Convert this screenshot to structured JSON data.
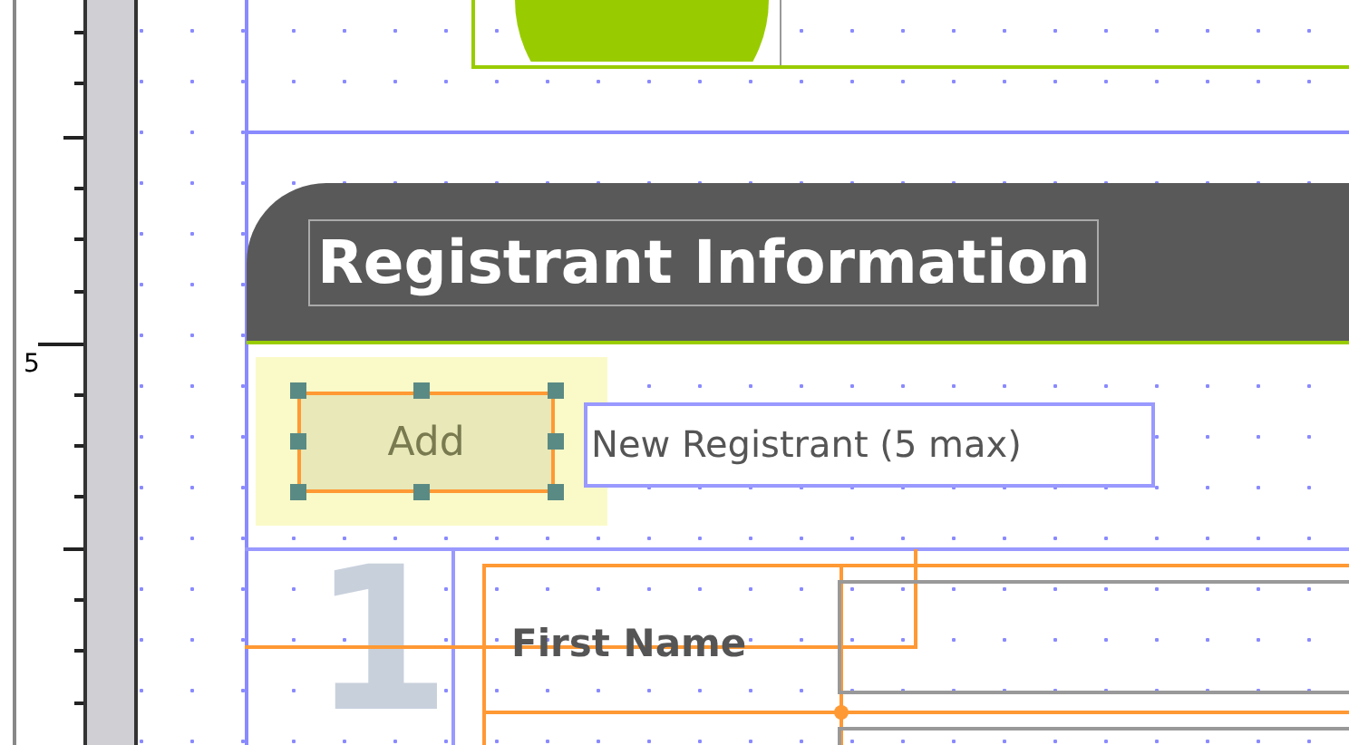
{
  "ruler": {
    "labels": [
      "5"
    ]
  },
  "header": {
    "title": "Registrant Information"
  },
  "add_control": {
    "label": "Add",
    "selected": true
  },
  "caption": {
    "text": "New Registrant (5 max)"
  },
  "row": {
    "number": "1",
    "field_label": "First Name"
  }
}
